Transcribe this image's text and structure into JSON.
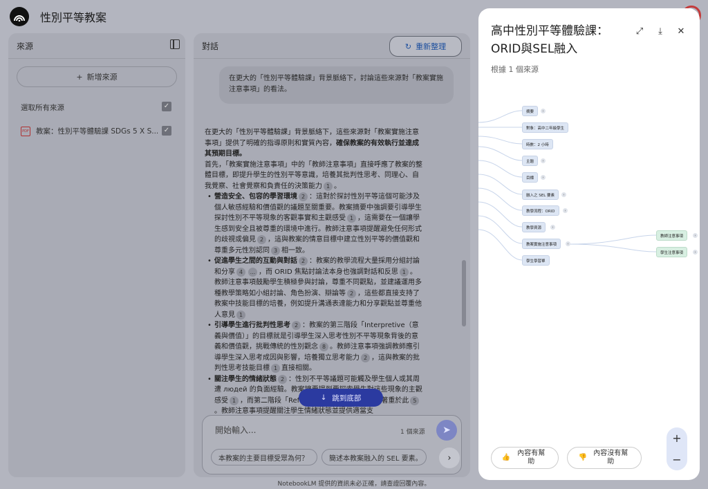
{
  "app": {
    "title": "性別平等教案",
    "footer": "NotebookLM 提供的資訊未必正確，請查證回覆內容。"
  },
  "sources": {
    "header": "來源",
    "add_label": "新增來源",
    "select_all": "選取所有來源",
    "items": [
      {
        "label": "教案：性別平等體驗課 SDGs 5 X S...",
        "checked": true
      }
    ]
  },
  "chat": {
    "header": "對話",
    "reorganize_label": "重新整理",
    "user_message": "在更大的「性別平等體驗課」背景脈絡下，討論這些來源對「教案實施注意事項」的看法。",
    "jump_label": "跳到底部",
    "input_placeholder": "開始輸入...",
    "source_count": "1 個來源",
    "suggestions": [
      "本教案的主要目標受眾為何？",
      "簡述本教案融入的 SEL 要素。"
    ]
  },
  "answer": {
    "intro_a": "在更大的「性別平等體驗課」背景脈絡下，這些來源對「教案實施注意事項」提供了明確的指導原則和實質內容，",
    "intro_b": "確保教案的有效執行並達成其預期目標。",
    "para2": "首先，「教案實施注意事項」中的「教師注意事項」直接呼應了教案的整體目標，即提升學生的性別平等意識，培養其批判性思考、同理心、自我覺察、社會覺察和負責任的決策能力",
    "c1": "1",
    "b1_title": "營造安全、包容的學習環境",
    "b1_text": "：這對於探討性別平等這個可能涉及個人敏感經驗和價值觀的議題至關重要。教案摘要中強調要引導學生探討性別不平等現象的客觀事實和主觀感受",
    "b1_text2": "，這需要在一個讓學生感到安全且被尊重的環境中進行。教師注意事項提醒避免任何形式的歧視或偏見",
    "b1_text3": "，這與教案的情意目標中建立性別平等的價值觀和尊重多元性別認同",
    "b1_text4": "相一致。",
    "b2_title": "促進學生之間的互動與對話",
    "b2_text": "：教案的教學流程大量採用分組討論和分享",
    "b2_text2": "，而 ORID 焦點討論法本身也強調對話和反思",
    "b2_text3": "。教師注意事項鼓勵學生積極參與討論，尊重不同觀點，並建議運用多種教學策略如小組討論、角色扮演、辯論等",
    "b2_text4": "，這些都直接支持了教案中技能目標的培養，例如提升溝通表達能力和分享觀點並尊重他人意見",
    "b3_title": "引導學生進行批判性思考",
    "b3_text": "：教案的第三階段「Interpretive（意義與價值）」的目標就是引導學生深入思考性別不平等現象背後的意義和價值觀，挑戰傳統的性別觀念",
    "b3_text2": "。教師注意事項強調教師應引導學生深入思考成因與影響，培養獨立思考能力",
    "b3_text3": "，這與教案的批判性思考技能目標",
    "b3_text4": "直接相關。",
    "b4_title": "關注學生的情緒狀態",
    "b4_text": "：性別不平等議題可能觸及學生個人或其周遭 людей 的負面經驗。教案摘要提到要探索學生對這些現象的主觀感受",
    "b4_text2": "，而第二階段「Reflective（感受與反應）」也著重於此",
    "b4_text3": "。教師注意事項提醒關注學生情緒狀態並提供適當支",
    "cites": {
      "two": "2",
      "three": "3",
      "four": "4",
      "five": "5",
      "eight": "8",
      "more": "..."
    }
  },
  "mindmap": {
    "title": "高中性別平等體驗課：ORID與SEL融入",
    "subtitle": "根據 1 個來源",
    "nodes": [
      "摘要",
      "對象：高中二年級學生",
      "時數：2 小時",
      "主題",
      "目標",
      "融入之 SEL 要素",
      "教學流程：ORID",
      "教學資源",
      "教案實施注意事項",
      "學生學習單"
    ],
    "child_nodes": [
      "教師注意事項",
      "學生注意事項"
    ],
    "feedback_good": "內容有幫助",
    "feedback_bad": "內容沒有幫助"
  }
}
